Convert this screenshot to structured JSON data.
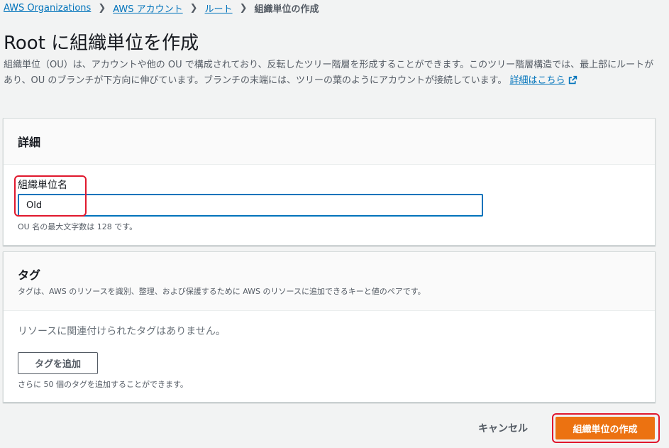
{
  "breadcrumb": {
    "items": [
      "AWS Organizations",
      "AWS アカウント",
      "ルート"
    ],
    "current": "組織単位の作成"
  },
  "page": {
    "title": "Root に組織単位を作成",
    "description": "組織単位（OU）は、アカウントや他の OU で構成されており、反転したツリー階層を形成することができます。このツリー階層構造では、最上部にルートがあり、OU のブランチが下方向に伸びています。ブランチの末端には、ツリーの葉のようにアカウントが接続しています。",
    "learn_more": "詳細はこちら"
  },
  "details": {
    "title": "詳細",
    "name_label": "組織単位名",
    "name_value": "Old",
    "name_hint": "OU 名の最大文字数は 128 です。"
  },
  "tags": {
    "title": "タグ",
    "description": "タグは、AWS のリソースを識別、整理、および保護するために AWS のリソースに追加できるキーと値のペアです。",
    "empty_text": "リソースに関連付けられたタグはありません。",
    "add_label": "タグを追加",
    "hint": "さらに 50 個のタグを追加することができます。"
  },
  "actions": {
    "cancel": "キャンセル",
    "create": "組織単位の作成"
  },
  "colors": {
    "link": "#0073bb",
    "primary": "#ec7211",
    "highlight": "#e0182d",
    "input_focus": "#0073bb"
  },
  "icons": {
    "breadcrumb_separator": "chevron-right-icon",
    "learn_more": "external-link-icon"
  }
}
